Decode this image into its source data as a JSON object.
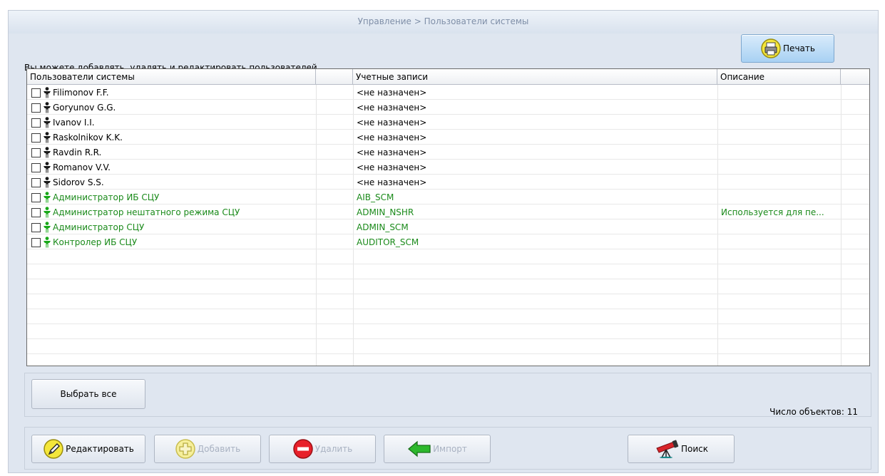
{
  "window": {
    "title": "Управление > Пользователи системы"
  },
  "hint": "Вы можете добавлять, удалять и редактировать пользователей",
  "print_button": {
    "label": "Печать",
    "icon": "printer-icon"
  },
  "grid": {
    "columns": [
      "Пользователи системы",
      "",
      "Учетные записи",
      "Описание"
    ],
    "rows": [
      {
        "name": "Filimonov F.F.",
        "account": "<не назначен>",
        "description": "",
        "type": "user"
      },
      {
        "name": "Goryunov G.G.",
        "account": "<не назначен>",
        "description": "",
        "type": "user"
      },
      {
        "name": "Ivanov I.I.",
        "account": "<не назначен>",
        "description": "",
        "type": "user"
      },
      {
        "name": "Raskolnikov K.K.",
        "account": "<не назначен>",
        "description": "",
        "type": "user"
      },
      {
        "name": "Ravdin R.R.",
        "account": "<не назначен>",
        "description": "",
        "type": "user"
      },
      {
        "name": "Romanov V.V.",
        "account": "<не назначен>",
        "description": "",
        "type": "user"
      },
      {
        "name": "Sidorov S.S.",
        "account": "<не назначен>",
        "description": "",
        "type": "user"
      },
      {
        "name": "Администратор ИБ СЦУ",
        "account": "AIB_SCM",
        "description": "",
        "type": "system"
      },
      {
        "name": "Администратор нештатного режима СЦУ",
        "account": "ADMIN_NSHR",
        "description": "Используется для пе...",
        "type": "system"
      },
      {
        "name": "Администратор СЦУ",
        "account": "ADMIN_SCM",
        "description": "",
        "type": "system"
      },
      {
        "name": "Контролер ИБ СЦУ",
        "account": "AUDITOR_SCM",
        "description": "",
        "type": "system"
      }
    ],
    "empty_rows": 7
  },
  "select_all_button": {
    "label": "Выбрать все"
  },
  "object_count": "Число объектов: 11",
  "toolbar": {
    "edit": {
      "label": "Редактировать",
      "icon": "pencil-icon",
      "enabled": true
    },
    "add": {
      "label": "Добавить",
      "icon": "plus-icon",
      "enabled": false
    },
    "delete": {
      "label": "Удалить",
      "icon": "minus-icon",
      "enabled": false
    },
    "import": {
      "label": "Импорт",
      "icon": "arrow-left-icon",
      "enabled": false
    },
    "search": {
      "label": "Поиск",
      "icon": "telescope-icon",
      "enabled": true
    }
  },
  "colors": {
    "user_text": "#000000",
    "system_text": "#1a8a1a",
    "user_icon": "#1a1a1a",
    "system_icon": "#19a819",
    "panel_bg": "#dfe6f0",
    "title_text": "#7f8fa8",
    "disabled_text": "#a9b2c2"
  }
}
